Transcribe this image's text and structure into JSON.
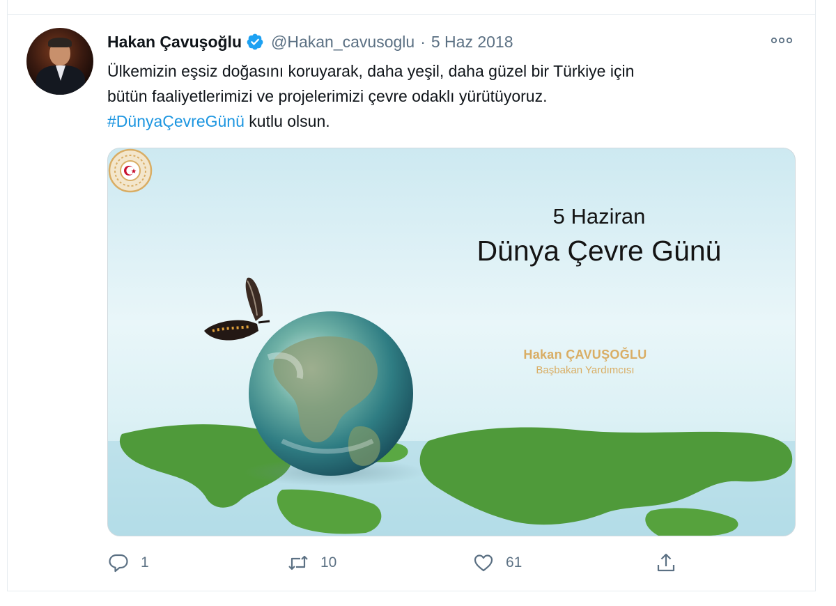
{
  "tweet": {
    "author": {
      "name": "Hakan Çavuşoğlu",
      "handle": "@Hakan_cavusoglu",
      "verified": true
    },
    "separator": "·",
    "date": "5 Haz 2018",
    "text_lines": [
      "Ülkemizin eşsiz doğasını koruyarak, daha yeşil, daha güzel bir Türkiye için",
      "bütün faaliyetlerimizi ve projelerimizi çevre odaklı yürütüyoruz."
    ],
    "hashtag": "#DünyaÇevreGünü",
    "text_tail": " kutlu olsun.",
    "media": {
      "date_line": "5 Haziran",
      "title": "Dünya Çevre Günü",
      "name_line": "Hakan ÇAVUŞOĞLU",
      "role_line": "Başbakan Yardımcısı"
    },
    "actions": {
      "reply_count": "1",
      "retweet_count": "10",
      "like_count": "61"
    }
  },
  "colors": {
    "text": "#0f1419",
    "secondary": "#5b7083",
    "accent": "#1b95e0",
    "verified": "#1da1f2",
    "gold": "#d9ad64"
  },
  "icons": {
    "verified": "verified-badge-icon",
    "more": "more-dots-icon",
    "reply": "reply-bubble-icon",
    "retweet": "retweet-arrows-icon",
    "like": "heart-icon",
    "share": "share-upload-icon"
  }
}
